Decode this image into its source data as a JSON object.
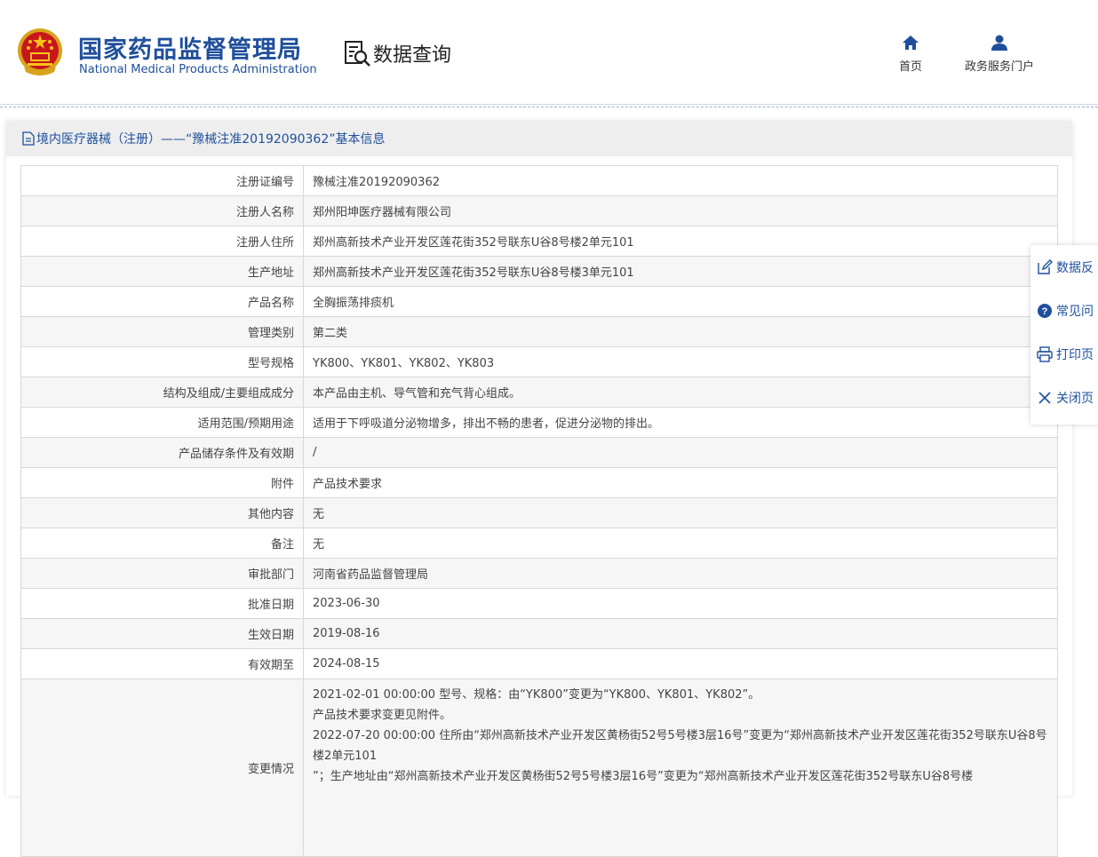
{
  "header": {
    "org_name_cn": "国家药品监督管理局",
    "org_name_en": "National Medical Products Administration",
    "query_title": "数据查询",
    "nav": [
      {
        "label": "首页",
        "icon": "home-icon"
      },
      {
        "label": "政务服务门户",
        "icon": "user-icon"
      }
    ]
  },
  "card": {
    "title": "境内医疗器械（注册）——“豫械注准20192090362”基本信息",
    "rows": [
      {
        "label": "注册证编号",
        "value": "豫械注准20192090362"
      },
      {
        "label": "注册人名称",
        "value": "郑州阳坤医疗器械有限公司"
      },
      {
        "label": "注册人住所",
        "value": "郑州高新技术产业开发区莲花街352号联东U谷8号楼2单元101"
      },
      {
        "label": "生产地址",
        "value": "郑州高新技术产业开发区莲花街352号联东U谷8号楼3单元101"
      },
      {
        "label": "产品名称",
        "value": "全胸振荡排痰机"
      },
      {
        "label": "管理类别",
        "value": "第二类"
      },
      {
        "label": "型号规格",
        "value": "YK800、YK801、YK802、YK803"
      },
      {
        "label": "结构及组成/主要组成成分",
        "value": "本产品由主机、导气管和充气背心组成。"
      },
      {
        "label": "适用范围/预期用途",
        "value": "适用于下呼吸道分泌物增多，排出不畅的患者，促进分泌物的排出。"
      },
      {
        "label": "产品储存条件及有效期",
        "value": "/"
      },
      {
        "label": "附件",
        "value": "产品技术要求"
      },
      {
        "label": "其他内容",
        "value": "无"
      },
      {
        "label": "备注",
        "value": "无"
      },
      {
        "label": "审批部门",
        "value": "河南省药品监督管理局"
      },
      {
        "label": "批准日期",
        "value": "2023-06-30"
      },
      {
        "label": "生效日期",
        "value": "2019-08-16"
      },
      {
        "label": "有效期至",
        "value": "2024-08-15"
      }
    ],
    "changes": {
      "label": "变更情况",
      "lines": [
        "2021-02-01 00:00:00 型号、规格：由“YK800”变更为“YK800、YK801、YK802”。",
        "产品技术要求变更见附件。",
        "2022-07-20 00:00:00 住所由“郑州高新技术产业开发区黄杨街52号5号楼3层16号”变更为“郑州高新技术产业开发区莲花街352号联东U谷8号楼2单元101",
        "”；生产地址由“郑州高新技术产业开发区黄杨街52号5号楼3层16号”变更为“郑州高新技术产业开发区莲花街352号联东U谷8号楼"
      ]
    }
  },
  "side_toolbar": {
    "items": [
      {
        "label": "数据反",
        "icon": "edit-icon"
      },
      {
        "label": "常见问",
        "icon": "help-icon"
      },
      {
        "label": "打印页",
        "icon": "print-icon"
      },
      {
        "label": "关闭页",
        "icon": "close-icon"
      }
    ]
  },
  "colors": {
    "brand_blue": "#1f4f9c",
    "row_alt": "#f6f6f6",
    "border": "#d8d8d8"
  }
}
